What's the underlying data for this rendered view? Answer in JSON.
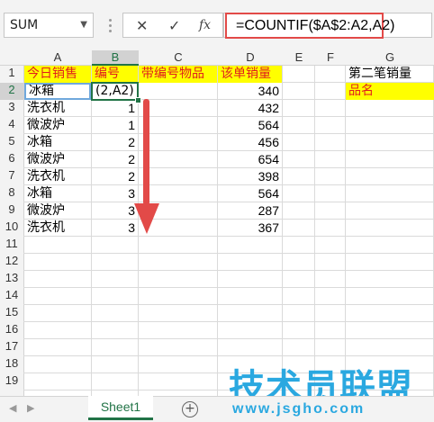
{
  "formula_bar": {
    "name_box": "SUM",
    "cancel_glyph": "✕",
    "enter_glyph": "✓",
    "fx_label": "fx",
    "formula": "=COUNTIF($A$2:A2,A2)"
  },
  "columns": [
    "A",
    "B",
    "C",
    "D",
    "E",
    "F",
    "G"
  ],
  "rows": [
    "1",
    "2",
    "3",
    "4",
    "5",
    "6",
    "7",
    "8",
    "9",
    "10",
    "11",
    "12",
    "13",
    "14",
    "15",
    "16",
    "17",
    "18",
    "19"
  ],
  "header_row": {
    "a": "今日销售",
    "b": "编号",
    "c": "带编号物品",
    "d": "该单销量",
    "g": "第二笔销量"
  },
  "data_rows": [
    {
      "a": "冰箱",
      "b": "(2,A2)",
      "d": "340"
    },
    {
      "a": "洗衣机",
      "b": "1",
      "d": "432"
    },
    {
      "a": "微波炉",
      "b": "1",
      "d": "564"
    },
    {
      "a": "冰箱",
      "b": "2",
      "d": "456"
    },
    {
      "a": "微波炉",
      "b": "2",
      "d": "654"
    },
    {
      "a": "洗衣机",
      "b": "2",
      "d": "398"
    },
    {
      "a": "冰箱",
      "b": "3",
      "d": "564"
    },
    {
      "a": "微波炉",
      "b": "3",
      "d": "287"
    },
    {
      "a": "洗衣机",
      "b": "3",
      "d": "367"
    }
  ],
  "g2": "品名",
  "sheet_tab": "Sheet1",
  "add_sheet_glyph": "+",
  "watermark": {
    "title": "技术员联盟",
    "site": "www.jsgho.com"
  },
  "colors": {
    "highlight": "#ffff00",
    "header_text": "#e01d1d",
    "arrow": "#e24a48",
    "selection": "#217346",
    "watermark": "#2aa8e0"
  }
}
